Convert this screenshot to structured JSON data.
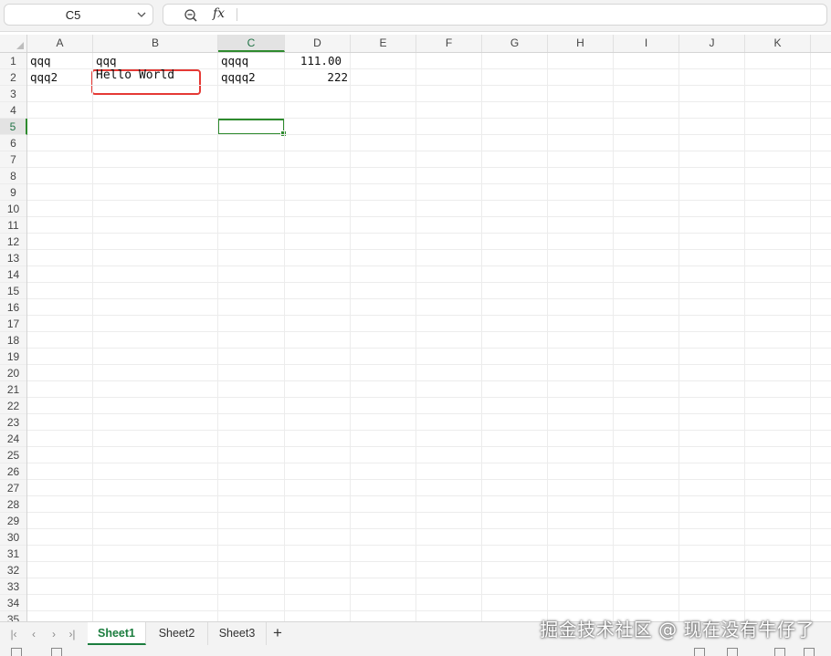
{
  "formula_bar": {
    "name_box": "C5",
    "fx_label": "fx",
    "formula": ""
  },
  "columns": [
    {
      "label": "A",
      "active": false
    },
    {
      "label": "B",
      "active": false
    },
    {
      "label": "C",
      "active": true
    },
    {
      "label": "D",
      "active": false
    },
    {
      "label": "E",
      "active": false
    },
    {
      "label": "F",
      "active": false
    },
    {
      "label": "G",
      "active": false
    },
    {
      "label": "H",
      "active": false
    },
    {
      "label": "I",
      "active": false
    },
    {
      "label": "J",
      "active": false
    },
    {
      "label": "K",
      "active": false
    }
  ],
  "rows": [
    "1",
    "2",
    "3",
    "4",
    "5",
    "6",
    "7",
    "8",
    "9",
    "10",
    "11",
    "12",
    "13",
    "14",
    "15",
    "16",
    "17",
    "18",
    "19",
    "20",
    "21",
    "22",
    "23",
    "24",
    "25",
    "26",
    "27",
    "28",
    "29",
    "30",
    "31",
    "32",
    "33",
    "34",
    "35"
  ],
  "active_row": "5",
  "cells": {
    "A1": "qqq",
    "B1": "qqq",
    "C1": "qqqq",
    "D1": "111.00",
    "A2": "qqq2",
    "B2": "Hello World",
    "C2": "qqqq2",
    "D2": "222"
  },
  "sheet_tabs": [
    {
      "label": "Sheet1",
      "active": true
    },
    {
      "label": "Sheet2",
      "active": false
    },
    {
      "label": "Sheet3",
      "active": false
    }
  ],
  "add_sheet_label": "+",
  "watermark": "掘金技术社区 @ 现在没有牛仔了",
  "colors": {
    "selection": "#2e8b2e",
    "annotation": "#e53935",
    "active_tab": "#1b7d3e"
  }
}
